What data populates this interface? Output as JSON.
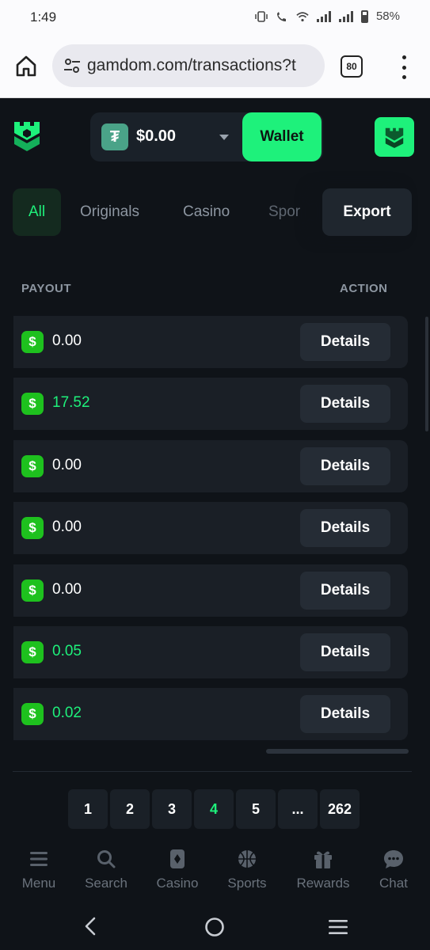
{
  "status_bar": {
    "time": "1:49",
    "battery": "58%"
  },
  "browser": {
    "url": "gamdom.com/transactions?t",
    "tab_count": "80"
  },
  "header": {
    "balance": "$0.00",
    "currency_symbol": "₮",
    "wallet_label": "Wallet"
  },
  "filters": {
    "tabs": [
      {
        "label": "All"
      },
      {
        "label": "Originals"
      },
      {
        "label": "Casino"
      },
      {
        "label": "Spor"
      }
    ],
    "export_label": "Export"
  },
  "table": {
    "headers": {
      "payout": "PAYOUT",
      "action": "ACTION"
    },
    "rows": [
      {
        "payout": "0.00",
        "coin": "$",
        "action": "Details"
      },
      {
        "payout": "17.52",
        "coin": "$",
        "action": "Details"
      },
      {
        "payout": "0.00",
        "coin": "$",
        "action": "Details"
      },
      {
        "payout": "0.00",
        "coin": "$",
        "action": "Details"
      },
      {
        "payout": "0.00",
        "coin": "$",
        "action": "Details"
      },
      {
        "payout": "0.05",
        "coin": "$",
        "action": "Details"
      },
      {
        "payout": "0.02",
        "coin": "$",
        "action": "Details"
      }
    ]
  },
  "pagination": {
    "pages": [
      "1",
      "2",
      "3",
      "4",
      "5",
      "...",
      "262"
    ],
    "current": "4"
  },
  "bottom_nav": {
    "items": [
      {
        "label": "Menu",
        "icon": "menu-icon"
      },
      {
        "label": "Search",
        "icon": "search-icon"
      },
      {
        "label": "Casino",
        "icon": "casino-icon"
      },
      {
        "label": "Sports",
        "icon": "sports-icon"
      },
      {
        "label": "Rewards",
        "icon": "gift-icon"
      },
      {
        "label": "Chat",
        "icon": "chat-icon"
      }
    ]
  },
  "colors": {
    "accent": "#1ef17b",
    "background": "#0f1318",
    "row": "#1a1f26",
    "coin": "#1ec11e"
  }
}
